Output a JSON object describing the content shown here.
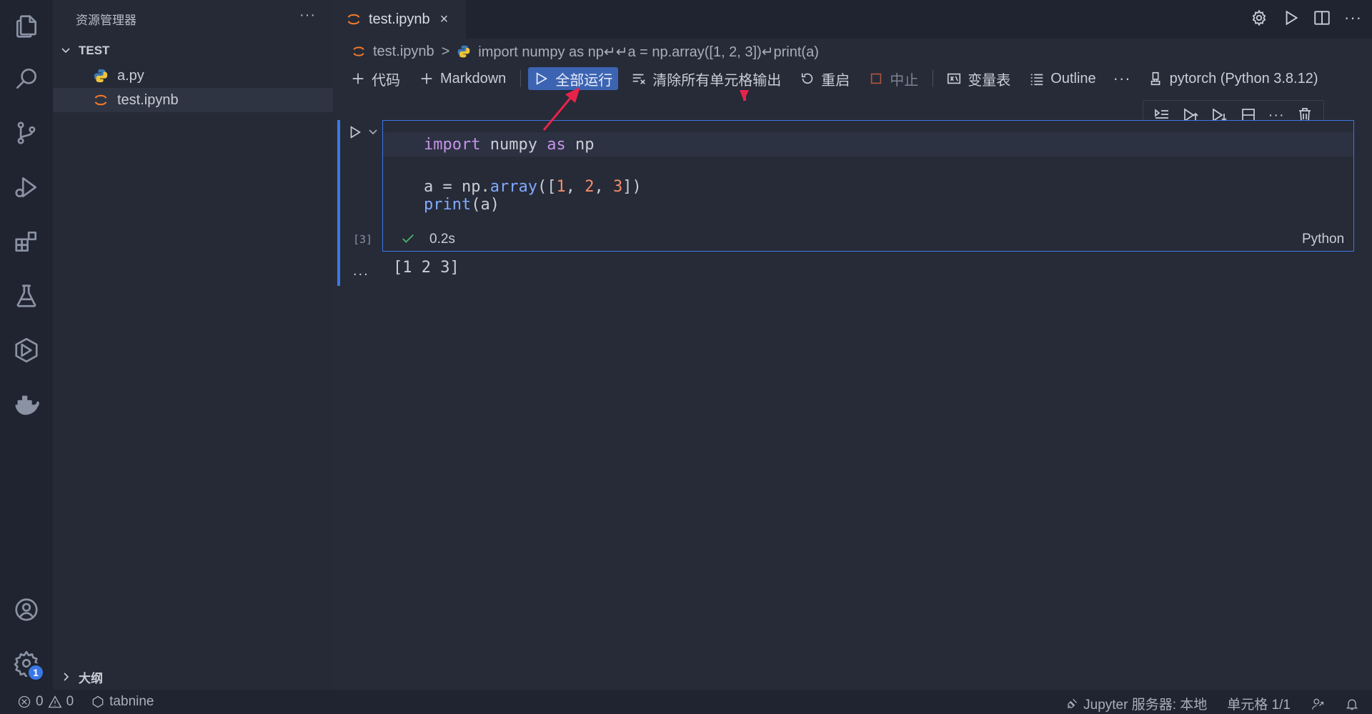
{
  "explorer": {
    "title": "资源管理器",
    "more": "···",
    "folder": "TEST",
    "files": [
      {
        "name": "a.py",
        "icon": "python-icon"
      },
      {
        "name": "test.ipynb",
        "icon": "jupyter-icon"
      }
    ],
    "outline_section": "大纲"
  },
  "activity_bar": {
    "items": [
      "explorer-icon",
      "search-icon",
      "source-control-icon",
      "run-debug-icon",
      "extensions-icon",
      "testing-icon",
      "remote-icon",
      "docker-icon",
      "account-icon",
      "settings-icon"
    ],
    "settings_badge": "1"
  },
  "tab": {
    "label": "test.ipynb",
    "close": "×"
  },
  "title_actions": {
    "more": "···"
  },
  "breadcrumb": {
    "file": "test.ipynb",
    "separator": ">",
    "cell": "import numpy as np↵↵a = np.array([1, 2, 3])↵print(a)"
  },
  "toolbar": {
    "code": "代码",
    "markdown": "Markdown",
    "run_all": "全部运行",
    "clear_outputs": "清除所有单元格输出",
    "restart": "重启",
    "interrupt": "中止",
    "variables": "变量表",
    "outline": "Outline",
    "more": "···",
    "kernel": "pytorch (Python 3.8.12)"
  },
  "cell_toolbar": {
    "more": "···"
  },
  "cell": {
    "code_lines": [
      [
        [
          "kw",
          "import"
        ],
        [
          "plain",
          " numpy "
        ],
        [
          "kw",
          "as"
        ],
        [
          "plain",
          " np"
        ]
      ],
      [],
      [
        [
          "plain",
          "a = np."
        ],
        [
          "fn",
          "array"
        ],
        [
          "plain",
          "(["
        ],
        [
          "num",
          "1"
        ],
        [
          "plain",
          ", "
        ],
        [
          "num",
          "2"
        ],
        [
          "plain",
          ", "
        ],
        [
          "num",
          "3"
        ],
        [
          "plain",
          "])"
        ]
      ],
      [
        [
          "fn",
          "print"
        ],
        [
          "plain",
          "(a)"
        ]
      ]
    ],
    "execution_count": "[3]",
    "duration": "0.2s",
    "language": "Python",
    "output_prefix": "...",
    "output": "[1 2 3]"
  },
  "statusbar": {
    "errors": "0",
    "warnings": "0",
    "tabnine": "tabnine",
    "jupyter_server": "Jupyter 服务器: 本地",
    "cell_position": "单元格 1/1"
  },
  "colors": {
    "accent": "#3b78e7",
    "annotation": "#e8234a",
    "run_all_bg": "#3c64b2"
  }
}
